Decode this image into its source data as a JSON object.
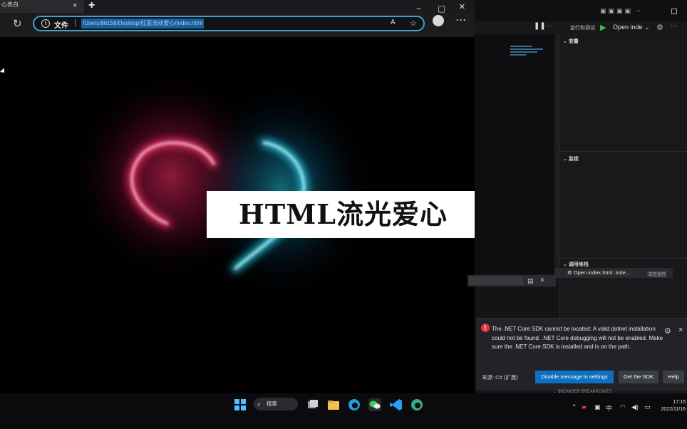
{
  "browser": {
    "tab_title": "心表白",
    "tab_close": "×",
    "new_tab": "+",
    "window_controls": {
      "minimize": "−",
      "maximize": "▢",
      "close": "×"
    },
    "reload_icon": "↻",
    "address_prefix": "文件",
    "address_separator": "|",
    "url": "/Users/86156/Desktop/红蓝流动爱心/index.html",
    "read_aloud_icon": "A",
    "favorite_icon": "☆",
    "more_icon": "···"
  },
  "page": {
    "banner_text": "HTML流光爱心",
    "heart_colors": {
      "left": "#ff2d6a",
      "right": "#22d3ee"
    }
  },
  "editor": {
    "run_label": "运行和调试",
    "run_button": "Open inde",
    "run_dropdown": "⌄",
    "pause_icon": "❚❚",
    "more": "···",
    "section_variables": "变量",
    "section_watch": "监视",
    "section_callstack": "调用堆栈",
    "callstack_item": "Open index.html: inde...",
    "callstack_status": "正在运行",
    "breakpoints_label": "BROWSER BREAKPOINTS"
  },
  "notification": {
    "message": "The .NET Core SDK cannot be located: A valid dotnet installation could not be found. .NET Core debugging will not be enabled. Make sure the .NET Core SDK is installed and is on the path.",
    "source": "来源: C# (扩展)",
    "buttons": [
      "Disable message in settings",
      "Get the SDK",
      "Help"
    ],
    "error_icon": "!",
    "gear_icon": "⚙",
    "close_icon": "×"
  },
  "taskbar": {
    "search_label": "搜索",
    "search_glyph": "⌕",
    "ime": "中",
    "time": "17:15",
    "date": "2022/11/16"
  }
}
